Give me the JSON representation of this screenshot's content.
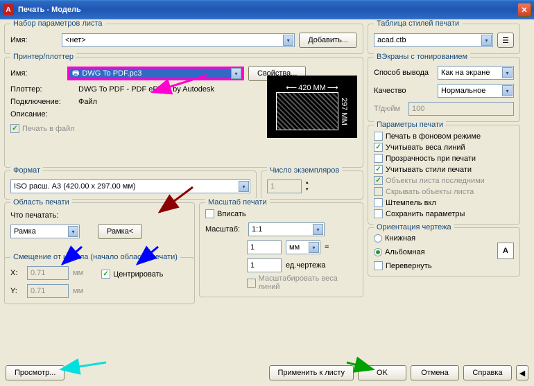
{
  "title": "Печать - Модель",
  "page_setup": {
    "title": "Набор параметров листа",
    "name_label": "Имя:",
    "name_value": "<нет>",
    "add_btn": "Добавить..."
  },
  "printer": {
    "title": "Принтер/плоттер",
    "name_label": "Имя:",
    "name_value": "DWG To PDF.pc3",
    "props_btn": "Свойства...",
    "plotter_label": "Плоттер:",
    "plotter_value": "DWG To PDF - PDF ePlot - by Autodesk",
    "conn_label": "Подключение:",
    "conn_value": "Файл",
    "desc_label": "Описание:",
    "to_file": "Печать в файл",
    "preview_w": "420 MM",
    "preview_h": "297 MM"
  },
  "paper": {
    "title": "Формат",
    "value": "ISO расш. A3 (420.00 x 297.00 мм)"
  },
  "copies": {
    "title": "Число экземпляров",
    "value": "1"
  },
  "area": {
    "title": "Область печати",
    "what_label": "Что печатать:",
    "what_value": "Рамка",
    "window_btn": "Рамка<"
  },
  "scale": {
    "title": "Масштаб печати",
    "fit": "Вписать",
    "scale_label": "Масштаб:",
    "scale_value": "1:1",
    "unit1_value": "1",
    "unit1_sel": "мм",
    "eq": "=",
    "unit2_value": "1",
    "unit2_label": "ед.чертежа",
    "lw": "Масштабировать веса линий"
  },
  "offset": {
    "title": "Смещение от начала (начало области печати)",
    "x_label": "X:",
    "x_value": "0.71",
    "y_label": "Y:",
    "y_value": "0.71",
    "unit": "мм",
    "center": "Центрировать"
  },
  "styletable": {
    "title": "Таблица стилей печати",
    "value": "acad.ctb"
  },
  "shaded": {
    "title": "ВЭкраны с тонированием",
    "mode_label": "Способ вывода",
    "mode_value": "Как на экране",
    "quality_label": "Качество",
    "quality_value": "Нормальное",
    "dpi_label": "Т/дюйм",
    "dpi_value": "100"
  },
  "options": {
    "title": "Параметры печати",
    "bg": "Печать в фоновом режиме",
    "lw": "Учитывать веса линий",
    "trans": "Прозрачность при печати",
    "styles": "Учитывать стили печати",
    "last": "Объекты листа последними",
    "hide": "Скрывать объекты листа",
    "stamp": "Штемпель вкл",
    "save": "Сохранить параметры"
  },
  "orient": {
    "title": "Ориентация чертежа",
    "portrait": "Книжная",
    "landscape": "Альбомная",
    "upside": "Перевернуть"
  },
  "buttons": {
    "preview": "Просмотр...",
    "apply": "Применить к листу",
    "ok": "OK",
    "cancel": "Отмена",
    "help": "Справка"
  }
}
